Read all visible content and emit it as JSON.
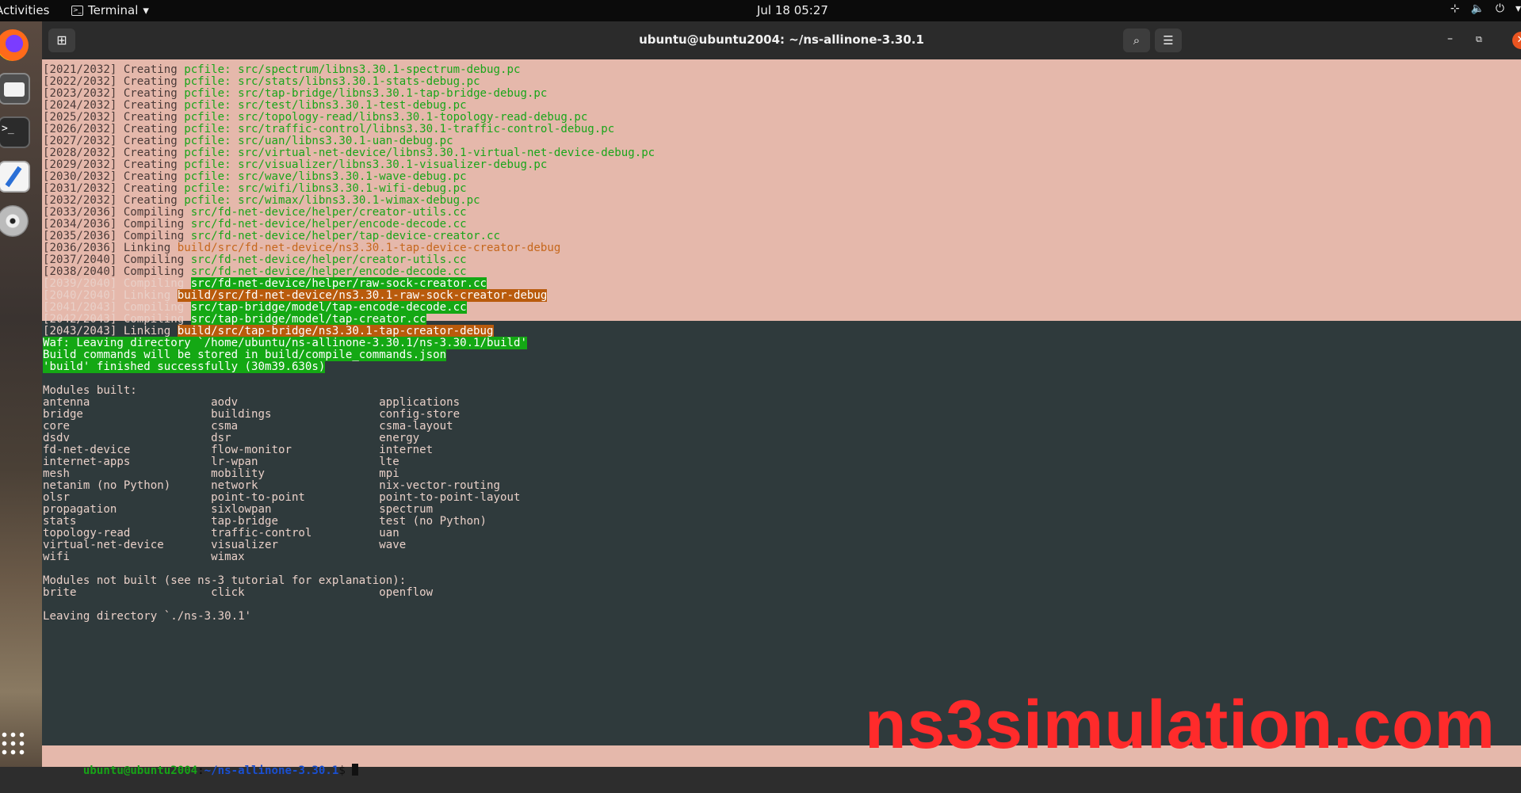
{
  "topbar": {
    "activities": "Activities",
    "app_name": "Terminal",
    "clock": "Jul 18  05:27"
  },
  "window": {
    "title": "ubuntu@ubuntu2004: ~/ns-allinone-3.30.1"
  },
  "terminal": {
    "lines": [
      {
        "p": "[2021/2032] Creating ",
        "k": "pcfile: src/spectrum/libns3.30.1-spectrum-debug.pc",
        "s": "g"
      },
      {
        "p": "[2022/2032] Creating ",
        "k": "pcfile: src/stats/libns3.30.1-stats-debug.pc",
        "s": "g"
      },
      {
        "p": "[2023/2032] Creating ",
        "k": "pcfile: src/tap-bridge/libns3.30.1-tap-bridge-debug.pc",
        "s": "g"
      },
      {
        "p": "[2024/2032] Creating ",
        "k": "pcfile: src/test/libns3.30.1-test-debug.pc",
        "s": "g"
      },
      {
        "p": "[2025/2032] Creating ",
        "k": "pcfile: src/topology-read/libns3.30.1-topology-read-debug.pc",
        "s": "g"
      },
      {
        "p": "[2026/2032] Creating ",
        "k": "pcfile: src/traffic-control/libns3.30.1-traffic-control-debug.pc",
        "s": "g"
      },
      {
        "p": "[2027/2032] Creating ",
        "k": "pcfile: src/uan/libns3.30.1-uan-debug.pc",
        "s": "g"
      },
      {
        "p": "[2028/2032] Creating ",
        "k": "pcfile: src/virtual-net-device/libns3.30.1-virtual-net-device-debug.pc",
        "s": "g"
      },
      {
        "p": "[2029/2032] Creating ",
        "k": "pcfile: src/visualizer/libns3.30.1-visualizer-debug.pc",
        "s": "g"
      },
      {
        "p": "[2030/2032] Creating ",
        "k": "pcfile: src/wave/libns3.30.1-wave-debug.pc",
        "s": "g"
      },
      {
        "p": "[2031/2032] Creating ",
        "k": "pcfile: src/wifi/libns3.30.1-wifi-debug.pc",
        "s": "g"
      },
      {
        "p": "[2032/2032] Creating ",
        "k": "pcfile: src/wimax/libns3.30.1-wimax-debug.pc",
        "s": "g"
      },
      {
        "p": "[2033/2036] Compiling ",
        "k": "src/fd-net-device/helper/creator-utils.cc",
        "s": "g"
      },
      {
        "p": "[2034/2036] Compiling ",
        "k": "src/fd-net-device/helper/encode-decode.cc",
        "s": "g"
      },
      {
        "p": "[2035/2036] Compiling ",
        "k": "src/fd-net-device/helper/tap-device-creator.cc",
        "s": "g"
      },
      {
        "p": "[2036/2036] Linking ",
        "k": "build/src/fd-net-device/ns3.30.1-tap-device-creator-debug",
        "s": "o"
      },
      {
        "p": "[2037/2040] Compiling ",
        "k": "src/fd-net-device/helper/creator-utils.cc",
        "s": "g"
      },
      {
        "p": "[2038/2040] Compiling ",
        "k": "src/fd-net-device/helper/encode-decode.cc",
        "s": "g"
      },
      {
        "p": "[2039/2040] Compiling ",
        "k": "src/fd-net-device/helper/raw-sock-creator.cc",
        "s": "hg"
      },
      {
        "p": "[2040/2040] Linking ",
        "k": "build/src/fd-net-device/ns3.30.1-raw-sock-creator-debug",
        "s": "ho"
      },
      {
        "p": "[2041/2043] Compiling ",
        "k": "src/tap-bridge/model/tap-encode-decode.cc",
        "s": "hg"
      },
      {
        "p": "[2042/2043] Compiling ",
        "k": "src/tap-bridge/model/tap-creator.cc",
        "s": "hg"
      },
      {
        "p": "[2043/2043] Linking ",
        "k": "build/src/tap-bridge/ns3.30.1-tap-creator-debug",
        "s": "ho"
      },
      {
        "p": "",
        "k": "Waf: Leaving directory `/home/ubuntu/ns-allinone-3.30.1/ns-3.30.1/build'",
        "s": "hg"
      },
      {
        "p": "",
        "k": "Build commands will be stored in build/compile_commands.json",
        "s": "hg"
      },
      {
        "p": "",
        "k": "'build' finished successfully (30m39.630s)",
        "s": "hg"
      },
      {
        "p": "",
        "k": "",
        "s": "w"
      },
      {
        "p": "Modules built:",
        "k": "",
        "s": "w"
      },
      {
        "p": "antenna                  aodv                     applications",
        "k": "",
        "s": "w"
      },
      {
        "p": "bridge                   buildings                config-store",
        "k": "",
        "s": "w"
      },
      {
        "p": "core                     csma                     csma-layout",
        "k": "",
        "s": "w"
      },
      {
        "p": "dsdv                     dsr                      energy",
        "k": "",
        "s": "w"
      },
      {
        "p": "fd-net-device            flow-monitor             internet",
        "k": "",
        "s": "w"
      },
      {
        "p": "internet-apps            lr-wpan                  lte",
        "k": "",
        "s": "w"
      },
      {
        "p": "mesh                     mobility                 mpi",
        "k": "",
        "s": "w"
      },
      {
        "p": "netanim (no Python)      network                  nix-vector-routing",
        "k": "",
        "s": "w"
      },
      {
        "p": "olsr                     point-to-point           point-to-point-layout",
        "k": "",
        "s": "w"
      },
      {
        "p": "propagation              sixlowpan                spectrum",
        "k": "",
        "s": "w"
      },
      {
        "p": "stats                    tap-bridge               test (no Python)",
        "k": "",
        "s": "w"
      },
      {
        "p": "topology-read            traffic-control          uan",
        "k": "",
        "s": "w"
      },
      {
        "p": "virtual-net-device       visualizer               wave",
        "k": "",
        "s": "w"
      },
      {
        "p": "wifi                     wimax",
        "k": "",
        "s": "w"
      },
      {
        "p": "",
        "k": "",
        "s": "w"
      },
      {
        "p": "Modules not built (see ns-3 tutorial for explanation):",
        "k": "",
        "s": "w"
      },
      {
        "p": "brite                    click                    openflow",
        "k": "",
        "s": "w"
      },
      {
        "p": "",
        "k": "",
        "s": "w"
      },
      {
        "p": "Leaving directory `./ns-3.30.1'",
        "k": "",
        "s": "w"
      }
    ],
    "prompt_user": "ubuntu@ubuntu2004",
    "prompt_sep": ":",
    "prompt_path": "~/ns-allinone-3.30.1",
    "prompt_end": "$ "
  },
  "watermark": "ns3simulation.com",
  "colors": {
    "pink_bg": "#e5b8ab",
    "dark_bg": "#2f3a3c",
    "green": "#1aa51a",
    "orange": "#c6671c",
    "watermark": "#ff2b2b"
  },
  "icons": [
    "firefox-icon",
    "files-icon",
    "terminal-icon",
    "text-editor-icon",
    "disc-icon",
    "app-grid-icon",
    "network-icon",
    "volume-icon",
    "power-icon",
    "search-icon",
    "menu-icon"
  ]
}
